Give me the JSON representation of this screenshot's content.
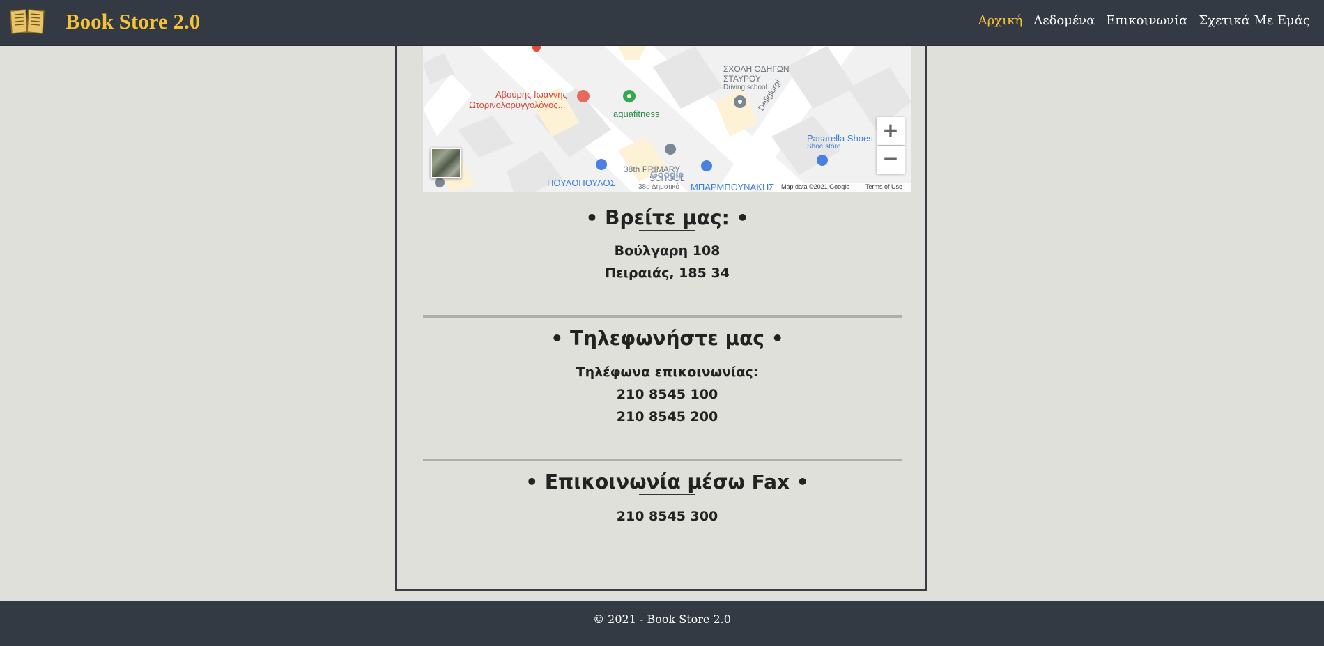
{
  "header": {
    "brand": "Book Store 2.0",
    "logo_icon": "open-book-icon",
    "nav": [
      "Αρχική",
      "Δεδομένα",
      "Επικοινωνία",
      "Σχετικά Με Εμάς"
    ],
    "active_nav": "Αρχική"
  },
  "map": {
    "labels": {
      "poi1": "Αβούρης Ιωάννης",
      "poi1b": "Ωτορινολαρυγγολόγος...",
      "poi2": "aquafitness",
      "poi3": "ΣΧΟΛΗ ΟΔΗΓΩΝ",
      "poi3b": "ΣΤΑΥΡΟΥ",
      "poi3c": "Driving school",
      "street": "Deligiorgi",
      "poi4": "Pasarella Shoes",
      "poi4b": "Shoe store",
      "poi5": "38th PRIMARY",
      "poi5b": "SCHOOL",
      "poi5c": "38ο Δημοτικό",
      "poi6": "ΠΟΥΛΟΠΟΥΛΟΣ",
      "poi7": "ΜΠΑΡΜΠΟΥΝΑΚΗΣ",
      "google": "Google",
      "mapdata": "Map data ©2021 Google",
      "terms": "Terms of Use"
    },
    "zoom_in": "+",
    "zoom_out": "−"
  },
  "find_us": {
    "title": "• Βρείτε μας: •",
    "lines": [
      "Βούλγαρη 108",
      "Πειραιάς, 185 34"
    ]
  },
  "call_us": {
    "title": "• Τηλεφωνήστε μας •",
    "lines": [
      "Τηλέφωνα επικοινωνίας:",
      "210 8545 100",
      "210 8545 200"
    ]
  },
  "fax": {
    "title": "• Επικοινωνία μέσω Fax •",
    "lines": [
      "210 8545 300"
    ]
  },
  "footer": {
    "text": "© 2021 - Book Store 2.0"
  },
  "colors": {
    "header_bg": "#343a43",
    "brand": "#f5c23a",
    "page_bg": "#dfe0d9"
  }
}
